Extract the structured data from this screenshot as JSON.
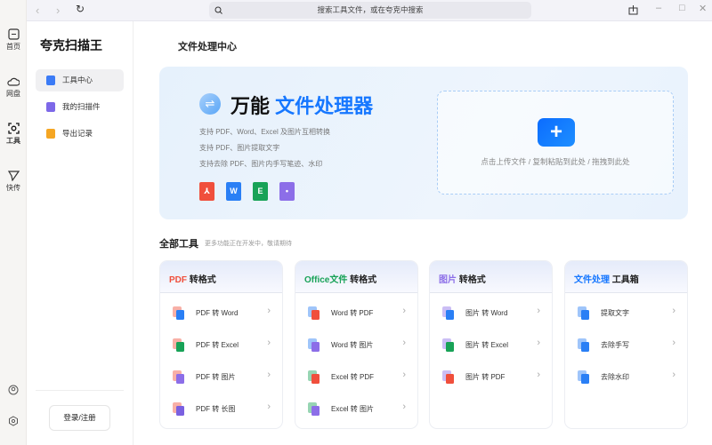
{
  "rail": {
    "items": [
      {
        "label": "首页",
        "icon": "home-icon"
      },
      {
        "label": "网盘",
        "icon": "cloud-icon"
      },
      {
        "label": "工具",
        "icon": "scan-icon"
      },
      {
        "label": "快传",
        "icon": "send-icon"
      }
    ]
  },
  "topbar": {
    "search_placeholder": "搜索工具文件，或在夸克中搜索",
    "back": "‹",
    "forward": "›",
    "refresh": "↻",
    "minimize": "–",
    "maximize": "□",
    "close": "✕"
  },
  "sidebar": {
    "brand": "夸克扫描王",
    "items": [
      {
        "label": "工具中心",
        "color": "#3b7bf6"
      },
      {
        "label": "我的扫描件",
        "color": "#7d68e8"
      },
      {
        "label": "导出记录",
        "color": "#f5a623"
      }
    ],
    "login": "登录/注册"
  },
  "main": {
    "title": "文件处理中心",
    "hero": {
      "title_black": "万能",
      "title_blue": "文件处理器",
      "features": [
        "支持 PDF、Word、Excel 及图片互相转换",
        "支持 PDF、图片提取文字",
        "支持去除 PDF、图片内手写笔迹、水印"
      ],
      "file_icons": [
        {
          "label": "",
          "color": "#f04f3c"
        },
        {
          "label": "W",
          "color": "#2a7ff5"
        },
        {
          "label": "E",
          "color": "#18a257"
        },
        {
          "label": "",
          "color": "#8c6ee8"
        }
      ],
      "upload_text": "点击上传文件 / 复制粘贴到此处 / 拖拽到此处"
    },
    "tools_title": "全部工具",
    "tools_subtitle": "更多功能正在开发中，敬请期待",
    "cards": [
      {
        "accent": "PDF",
        "accent_color": "#f04f3c",
        "rest": " 转格式",
        "items": [
          "PDF 转 Word",
          "PDF 转 Excel",
          "PDF 转 图片",
          "PDF 转 长图"
        ]
      },
      {
        "accent": "Office文件",
        "accent_color": "#18a257",
        "rest": " 转格式",
        "items": [
          "Word 转 PDF",
          "Word 转 图片",
          "Excel 转 PDF",
          "Excel 转 图片"
        ]
      },
      {
        "accent": "图片",
        "accent_color": "#8c6ee8",
        "rest": " 转格式",
        "items": [
          "图片 转 Word",
          "图片 转 Excel",
          "图片 转 PDF"
        ]
      },
      {
        "accent": "文件处理",
        "accent_color": "#1677ff",
        "rest": " 工具箱",
        "items": [
          "提取文字",
          "去除手写",
          "去除水印"
        ]
      }
    ]
  }
}
